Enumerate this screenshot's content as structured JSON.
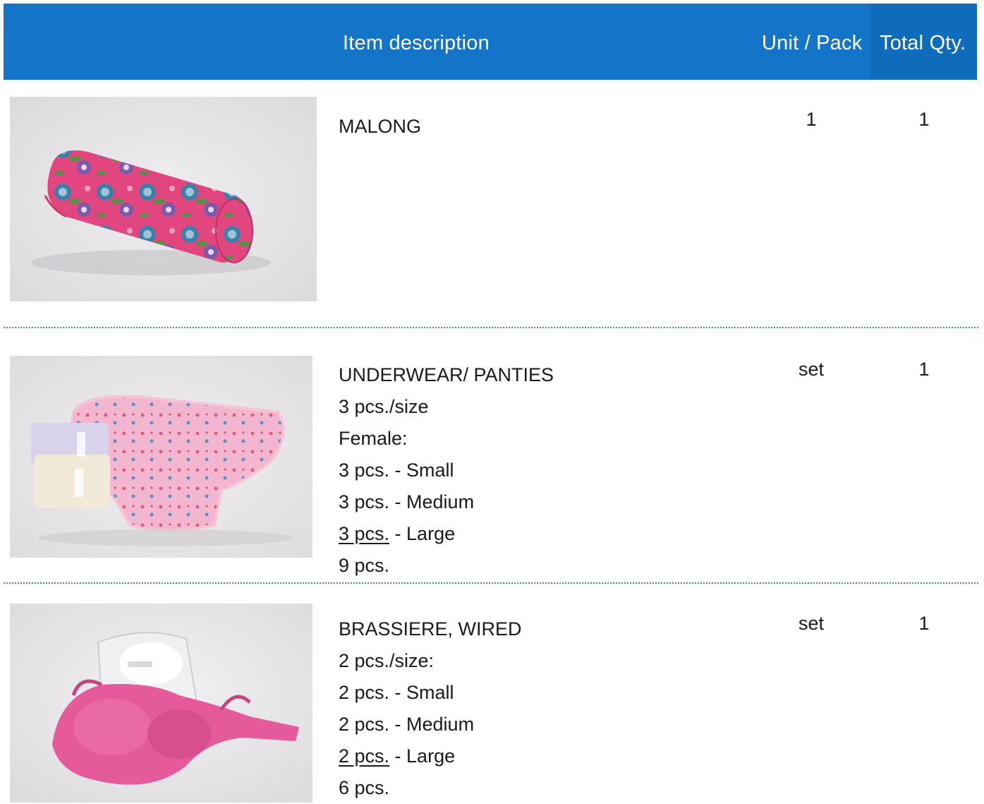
{
  "header": {
    "item_description": "Item description",
    "unit_pack": "Unit / Pack",
    "total_qty": "Total Qty."
  },
  "colors": {
    "header_bg": "#1474c8",
    "header_total_bg": "#0f6cba",
    "separator": "#3c89c8"
  },
  "items": [
    {
      "photo": "rolled-floral-malong-photo",
      "title": "MALONG",
      "lines": [],
      "unit": "1",
      "qty": "1"
    },
    {
      "photo": "pink-panties-pack-photo",
      "title": "UNDERWEAR/ PANTIES",
      "lines": [
        "3 pcs./size",
        "Female:",
        "3 pcs. - Small",
        "3 pcs. - Medium"
      ],
      "last_size": {
        "count": "3 pcs.",
        "rest": " - Large"
      },
      "total": "9 pcs.",
      "unit": "set",
      "qty": "1"
    },
    {
      "photo": "pink-wired-brassiere-photo",
      "title": "BRASSIERE, WIRED",
      "lines": [
        "2 pcs./size:",
        "2 pcs. - Small",
        "2 pcs. - Medium"
      ],
      "last_size": {
        "count": "2 pcs.",
        "rest": " - Large"
      },
      "total": "6 pcs.",
      "unit": "set",
      "qty": "1"
    }
  ]
}
